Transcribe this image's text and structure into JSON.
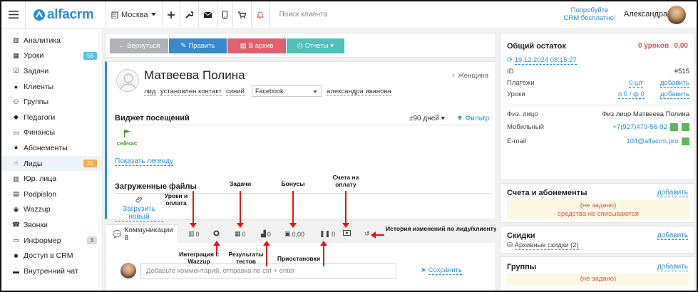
{
  "topbar": {
    "logo": "alfacrm",
    "city": "Москва",
    "search_placeholder": "Поиск клиента",
    "promo_line1": "Попробуйте",
    "promo_line2": "CRM бесплатно!",
    "user_name": "Александра"
  },
  "sidebar": {
    "items": [
      {
        "label": "Аналитика",
        "icon": "book-icon"
      },
      {
        "label": "Уроки",
        "icon": "calendar-icon",
        "badge": "56",
        "badge_color": "#5bc0de"
      },
      {
        "label": "Задачи",
        "icon": "tasks-icon"
      },
      {
        "label": "Клиенты",
        "icon": "user-icon"
      },
      {
        "label": "Группы",
        "icon": "group-icon"
      },
      {
        "label": "Педагоги",
        "icon": "graduation-cap-icon"
      },
      {
        "label": "Финансы",
        "icon": "money-icon"
      },
      {
        "label": "Абонементы",
        "icon": "star-icon"
      },
      {
        "label": "Лиды",
        "icon": "lead-icon",
        "badge": "21",
        "badge_color": "#f0ad4e",
        "active": true
      },
      {
        "label": "Юр. лица",
        "icon": "building-icon"
      },
      {
        "label": "Podpislon",
        "icon": "document-icon"
      },
      {
        "label": "Wazzup",
        "icon": "chat-icon"
      },
      {
        "label": "Звонки",
        "icon": "phone-icon"
      },
      {
        "label": "Информер",
        "icon": "monitor-icon",
        "badge": "3",
        "badge_color": "#d5dde5"
      },
      {
        "label": "Доступ в CRM",
        "icon": "lock-icon"
      },
      {
        "label": "Внутренний чат",
        "icon": "message-icon"
      }
    ]
  },
  "actions": {
    "back": "Вернуться",
    "edit": "Править",
    "archive": "В архив",
    "reports": "Отчеты"
  },
  "lead": {
    "name": "Матвеева Полина",
    "gender": "Женщина",
    "tag_lead": "лид",
    "tag_status": "установлен контакт",
    "tag_color": "синий",
    "source": "Facebook",
    "manager": "александра иванова"
  },
  "visits": {
    "title": "Виджет посещений",
    "range": "±90 дней",
    "filter": "Фильтр",
    "now": "сейчас",
    "legend": "Показать легенду"
  },
  "files": {
    "title": "Загруженные файлы",
    "upload": "Загрузить новый"
  },
  "annotations": {
    "lessons": "Уроки и оплата",
    "tasks": "Задачи",
    "bonuses": "Бонусы",
    "invoices": "Счета на оплату",
    "history": "История изменений по лиду/клиенту",
    "wazzup": "Интеграция с Wazzup",
    "tests": "Результаты тестов",
    "pauses": "Приостановки"
  },
  "tabs": {
    "communications": "Коммуникации 8",
    "lessons_count": "0",
    "tasks_count": "0",
    "tests_count": "0",
    "bonus_count": "0,00",
    "pause_count": "0"
  },
  "comment": {
    "placeholder": "Добавьте комментарий, отправка по ctrl + enter",
    "save": "Сохранить"
  },
  "balance": {
    "title": "Общий остаток",
    "lessons": "0 уроков",
    "amount": "0,00",
    "datetime": "19.12.2024 08:15:27",
    "id_label": "ID",
    "id_value": "#515",
    "payments_label": "Платежи",
    "payments_value": "0 шт",
    "payments_add": "добавить",
    "lessons_label": "Уроки",
    "lessons_value": "п 0 / ф 0",
    "lessons_add": "добавить"
  },
  "contacts": {
    "person_label": "Физ. лицо",
    "person_value": "Физ.лицо Матвеева Полина",
    "mobile_label": "Мобильный",
    "mobile_value": "+7(927)479-56-92",
    "email_label": "E-mail",
    "email_value": "104@alfacrm.pro"
  },
  "subscriptions": {
    "title": "Счета и абонементы",
    "add": "добавить",
    "empty": "(не задано)",
    "note": "средства не списываются"
  },
  "discounts": {
    "title": "Скидки",
    "add": "добавить",
    "archived": "Архивные скидки (2)"
  },
  "groups": {
    "title": "Группы",
    "add": "добавить",
    "empty": "(не задано)"
  },
  "colors": {
    "brand": "#2b8fd6",
    "back_btn": "#aeb3b8",
    "edit_btn": "#3a89c9",
    "archive_btn": "#e0606e",
    "reports_btn": "#4fc1b6",
    "danger": "#d9534f",
    "annotation_arrow": "#e11111"
  }
}
